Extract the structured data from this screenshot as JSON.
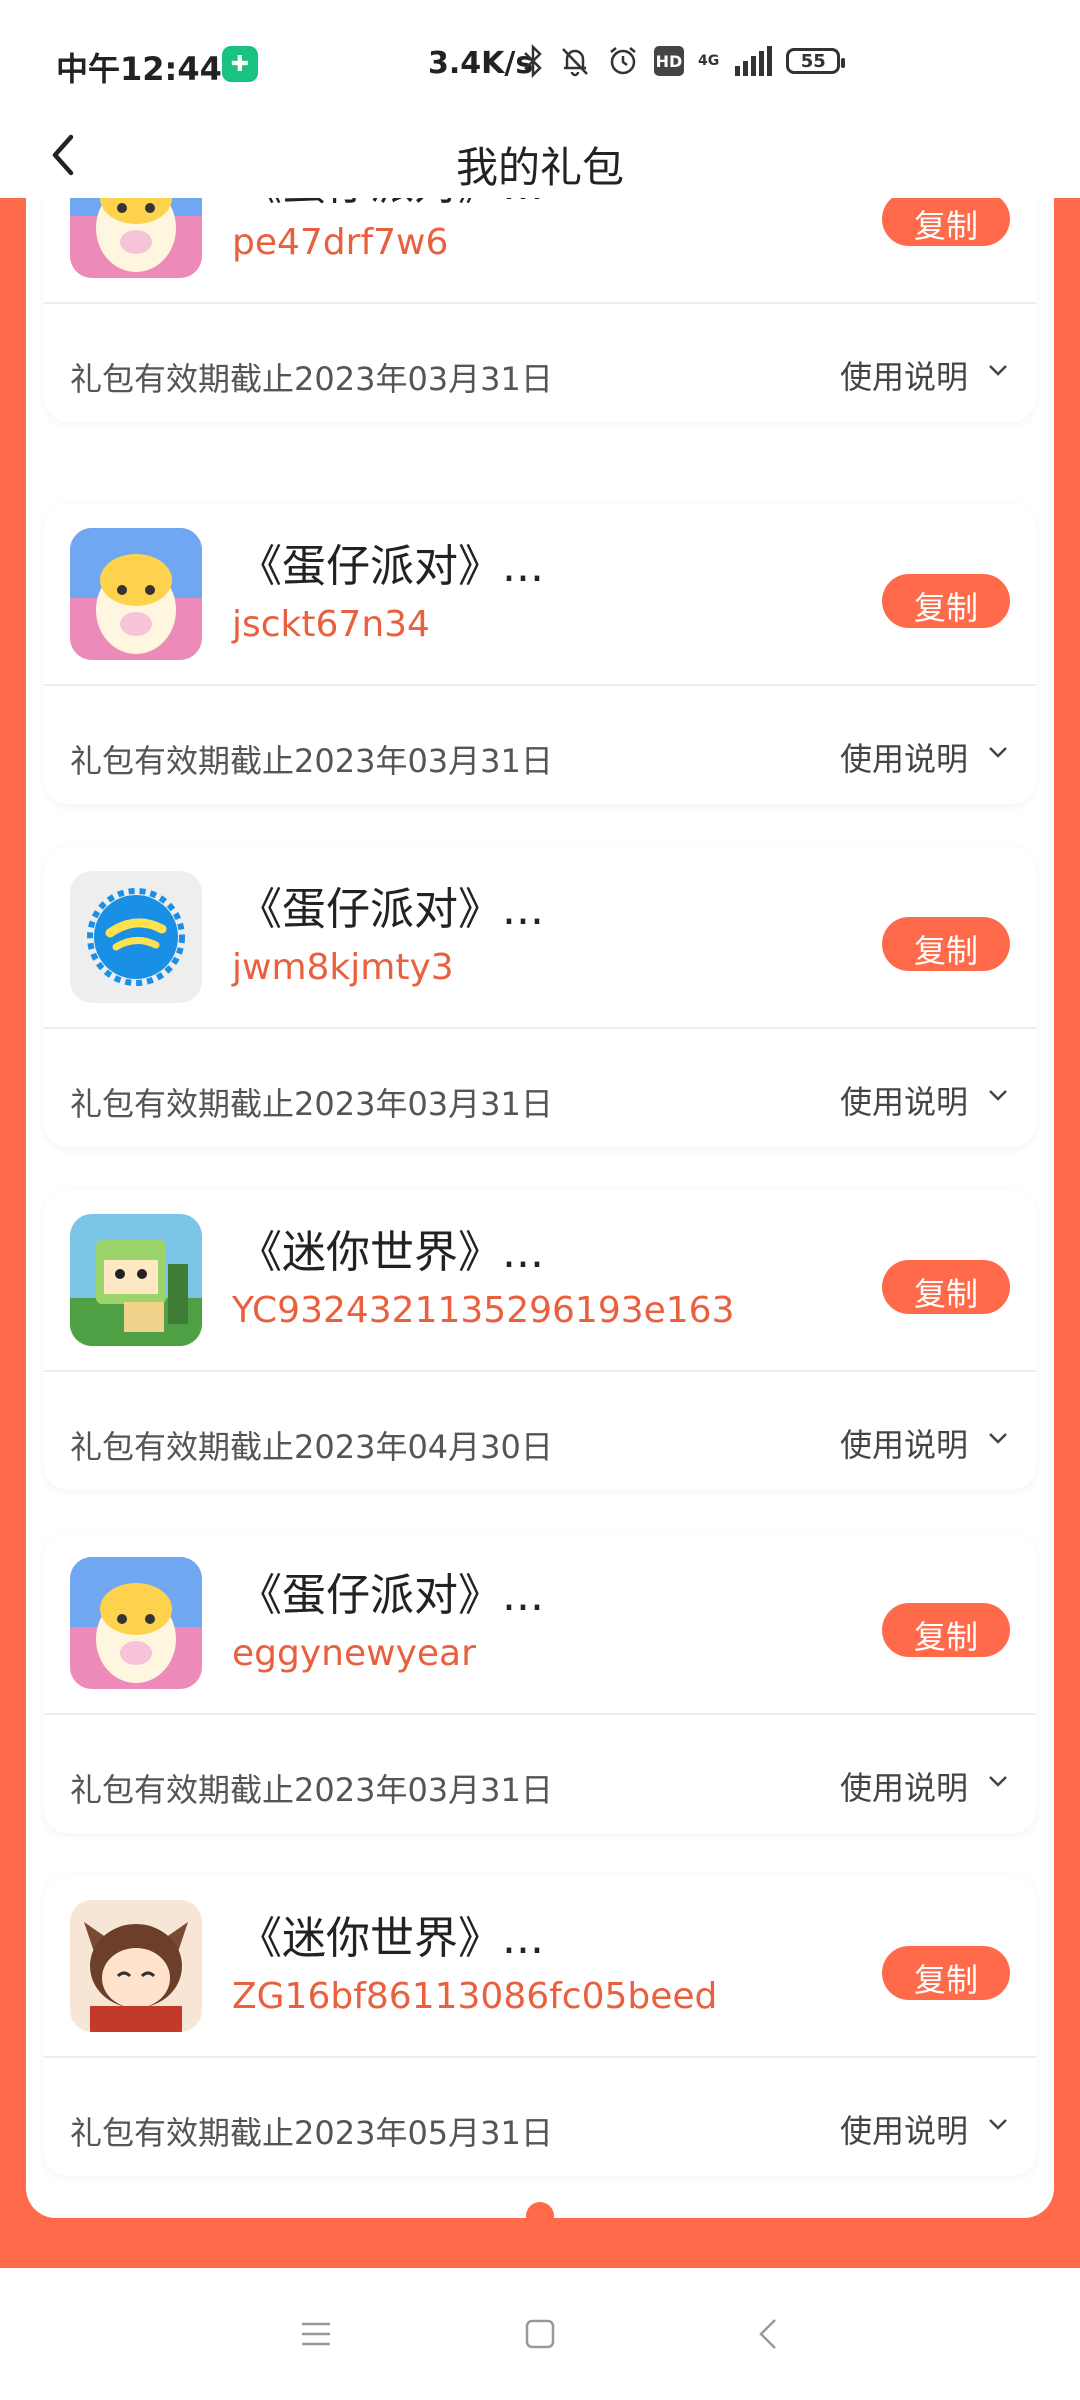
{
  "status_bar": {
    "time": "中午12:44",
    "net_speed": "3.4K/s",
    "network": "4G",
    "hd": "HD",
    "battery": "55"
  },
  "header": {
    "title": "我的礼包"
  },
  "gifts": [
    {
      "game": "《蛋仔派对》...",
      "code": "pe47drf7w6",
      "expiry": "礼包有效期截止2023年03月31日",
      "copy_label": "复制",
      "instructions_label": "使用说明",
      "icon": "eggy-party-icon"
    },
    {
      "game": "《蛋仔派对》...",
      "code": "jsckt67n34",
      "expiry": "礼包有效期截止2023年03月31日",
      "copy_label": "复制",
      "instructions_label": "使用说明",
      "icon": "eggy-party-icon"
    },
    {
      "game": "《蛋仔派对》...",
      "code": "jwm8kjmty3",
      "expiry": "礼包有效期截止2023年03月31日",
      "copy_label": "复制",
      "instructions_label": "使用说明",
      "icon": "bottle-cap-icon"
    },
    {
      "game": "《迷你世界》...",
      "code": "YC9324321135296193e163",
      "expiry": "礼包有效期截止2023年04月30日",
      "copy_label": "复制",
      "instructions_label": "使用说明",
      "icon": "mini-world-icon"
    },
    {
      "game": "《蛋仔派对》...",
      "code": "eggynewyear",
      "expiry": "礼包有效期截止2023年03月31日",
      "copy_label": "复制",
      "instructions_label": "使用说明",
      "icon": "eggy-party-icon"
    },
    {
      "game": "《迷你世界》...",
      "code": "ZG16bf86113086fc05beed",
      "expiry": "礼包有效期截止2023年05月31日",
      "copy_label": "复制",
      "instructions_label": "使用说明",
      "icon": "mini-world-girl-icon"
    }
  ],
  "colors": {
    "accent": "#ff6b4a",
    "code_text": "#e9603e"
  }
}
